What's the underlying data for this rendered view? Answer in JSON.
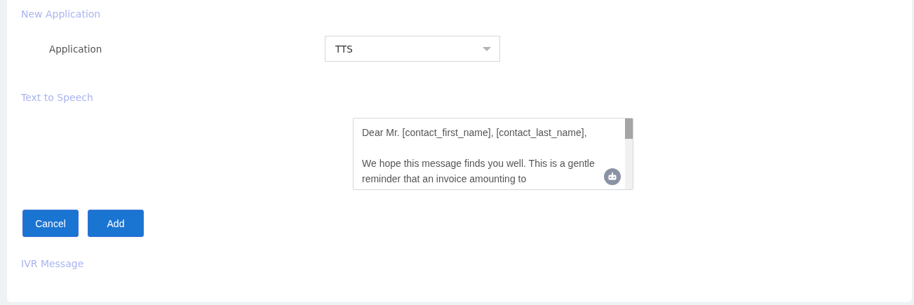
{
  "sections": [
    {
      "title": "New Application"
    },
    {
      "title": "Text to Speech"
    },
    {
      "title": "IVR Message"
    }
  ],
  "application": {
    "label": "Application",
    "value": "TTS"
  },
  "message": {
    "paragraphs": [
      [
        "Dear Mr. [contact_first_name], [contact_last_name],"
      ],
      [
        "We hope this message finds you well. This is a gentle",
        "reminder that an invoice amounting to"
      ]
    ]
  },
  "buttons": [
    {
      "label": "Cancel"
    },
    {
      "label": "Add"
    }
  ]
}
